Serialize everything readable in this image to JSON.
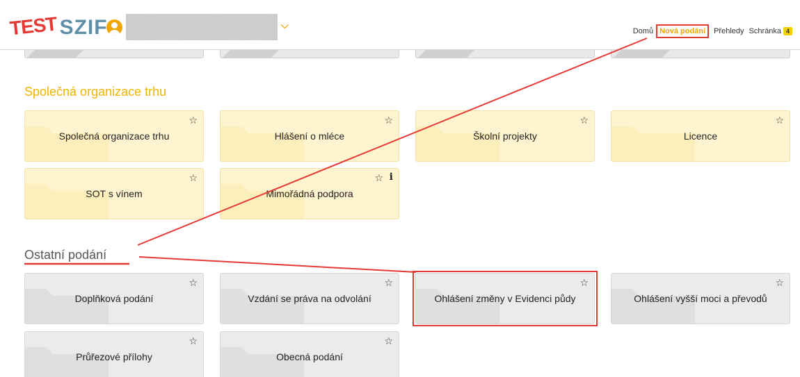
{
  "app": {
    "logo_test": "TEST",
    "logo_name": "SZIF"
  },
  "user": {
    "icon": "user-circle-icon",
    "dropdown_icon": "chevron-down-icon"
  },
  "nav": {
    "items": [
      {
        "label": "Domů",
        "active": false
      },
      {
        "label": "Nová podání",
        "active": true
      },
      {
        "label": "Přehledy",
        "active": false
      },
      {
        "label": "Schránka",
        "active": false,
        "badge": "4"
      }
    ]
  },
  "sections": [
    {
      "title": "Společná organizace trhu",
      "color": "#f0b400",
      "tiles": [
        {
          "label": "Společná organizace trhu"
        },
        {
          "label": "Hlášení o mléce"
        },
        {
          "label": "Školní projekty"
        },
        {
          "label": "Licence"
        },
        {
          "label": "SOT s vínem"
        },
        {
          "label": "Mimořádná podpora",
          "info": "i"
        }
      ]
    },
    {
      "title": "Ostatní podání",
      "color": "#555555",
      "tiles": [
        {
          "label": "Doplňková podání"
        },
        {
          "label": "Vzdání se práva na odvolání"
        },
        {
          "label": "Ohlášení změny v Evidenci půdy"
        },
        {
          "label": "Ohlášení vyšší moci a převodů"
        },
        {
          "label": "Průřezové přílohy"
        },
        {
          "label": "Obecná podání"
        }
      ]
    }
  ],
  "icons": {
    "star": "☆",
    "favorite_icon": "star-outline-icon",
    "folder_icon": "folder-icon"
  },
  "colors": {
    "accent": "#f0a500",
    "annotation": "#e53935",
    "tile_yellow": "#fef4cf",
    "tile_grey": "#ebebeb"
  }
}
